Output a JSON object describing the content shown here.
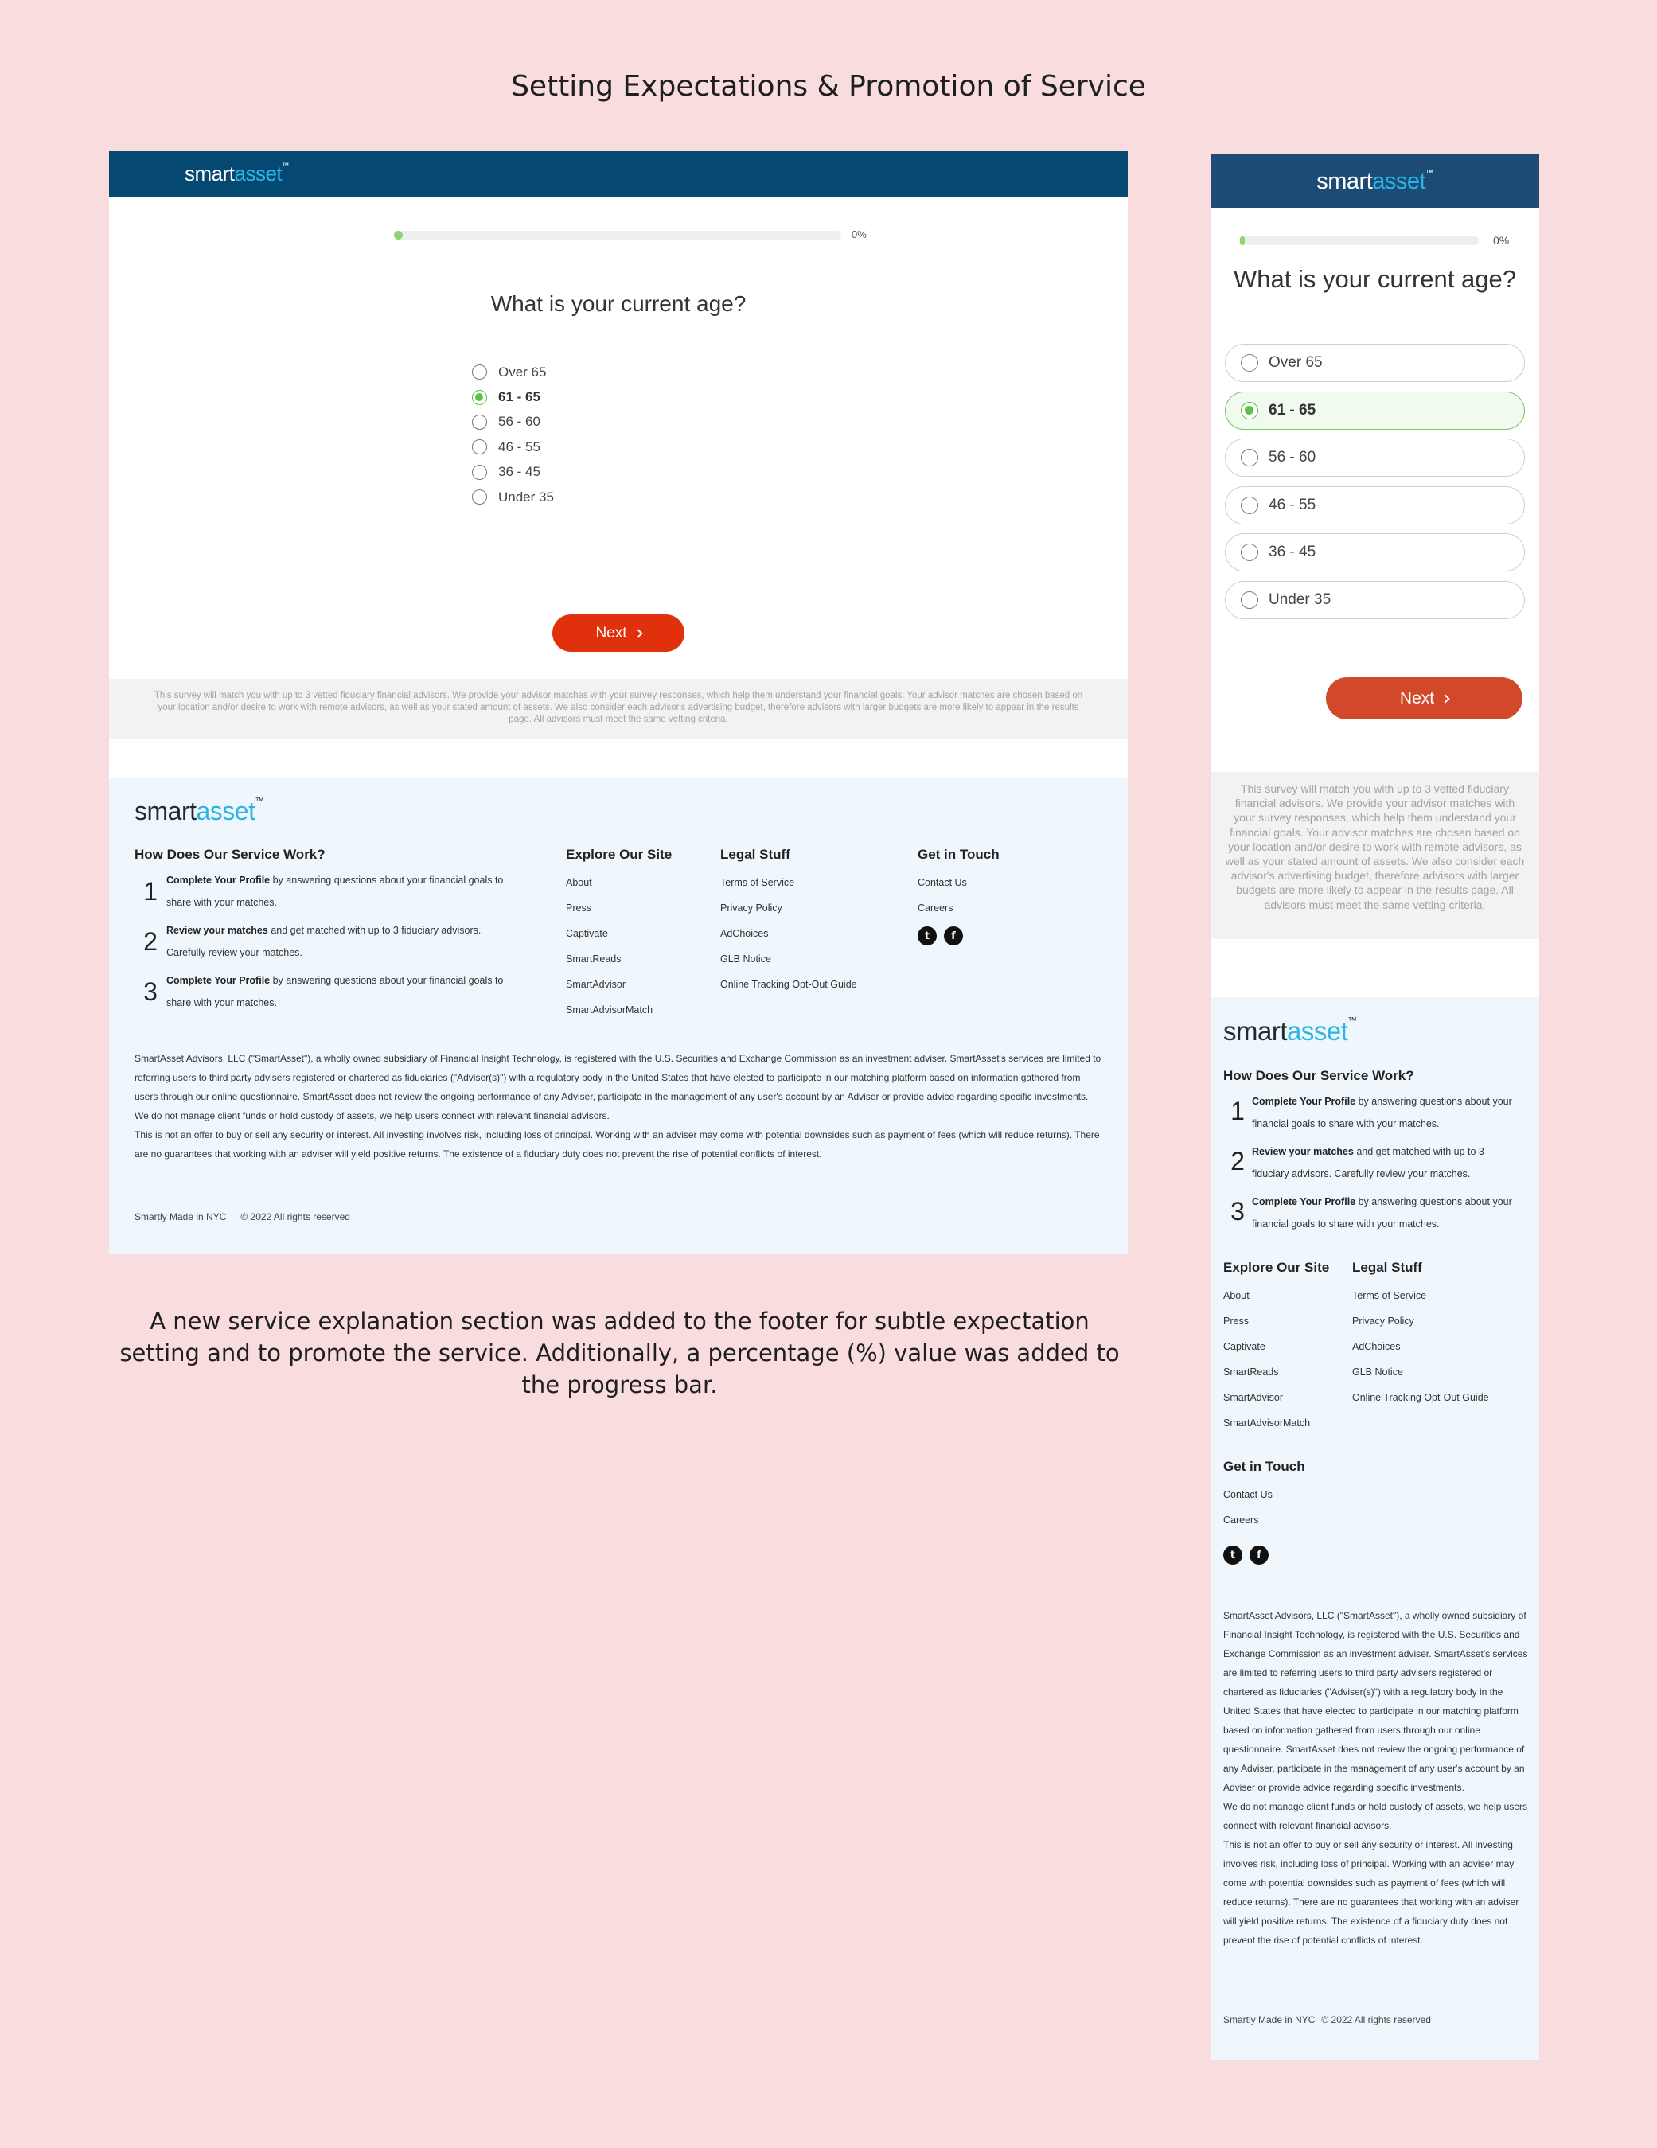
{
  "page_title": "Setting Expectations & Promotion of Service",
  "caption": "A new service explanation section was added to the footer for subtle expectation setting and to promote the service. Additionally, a percentage (%) value was added to the progress bar.",
  "brand": {
    "logo_part1": "smart",
    "logo_part2": "asset",
    "logo_tm": "™"
  },
  "colors": {
    "header": "#054872",
    "accent_green": "#5ec04a",
    "next_button": "#e0310c",
    "footer_bg": "#eff7fc",
    "background": "#f9dcdd"
  },
  "survey": {
    "progress_fraction": 0.02,
    "progress_label": "0%",
    "question": "What is your current age?",
    "options": [
      "Over 65",
      "61 - 65",
      "56 - 60",
      "46 - 55",
      "36 - 45",
      "Under 35"
    ],
    "selected": "61 - 65",
    "next_label": "Next",
    "disclaimer": "This survey will match you with up to 3 vetted fiduciary financial advisors. We provide your advisor matches with your survey responses, which help them understand your financial goals. Your advisor matches are chosen based on your location and/or desire to work with remote advisors, as well as your stated amount of assets. We also consider each advisor's advertising budget, therefore advisors with larger budgets are more likely to appear in the results page. All advisors must meet the same vetting criteria."
  },
  "footer": {
    "how_title": "How Does Our Service Work?",
    "steps": [
      {
        "num": "1",
        "bold": "Complete Your Profile",
        "text": " by answering questions about your financial goals to share with your matches."
      },
      {
        "num": "2",
        "bold": "Review your matches",
        "text": " and get matched with up to 3 fiduciary advisors. Carefully review your matches."
      },
      {
        "num": "3",
        "bold": "Complete Your Profile",
        "text": " by answering questions about your financial goals to share with your matches."
      }
    ],
    "explore_title": "Explore Our Site",
    "explore_links": [
      "About",
      "Press",
      "Captivate",
      "SmartReads",
      "SmartAdvisor",
      "SmartAdvisorMatch"
    ],
    "legal_title": "Legal Stuff",
    "legal_links": [
      "Terms of Service",
      "Privacy Policy",
      "AdChoices",
      "GLB Notice",
      "Online Tracking Opt-Out Guide"
    ],
    "contact_title": "Get in Touch",
    "contact_links": [
      "Contact Us",
      "Careers"
    ],
    "social_icons": [
      "twitter-icon",
      "facebook-icon"
    ],
    "legal_text_1": "SmartAsset Advisors, LLC (\"SmartAsset\"), a wholly owned subsidiary of Financial Insight Technology, is registered with the U.S. Securities and Exchange Commission as an investment adviser. SmartAsset's services are limited to referring users to third party advisers registered or chartered as fiduciaries (\"Adviser(s)\") with a regulatory body in the United States that have elected to participate in our matching platform based on information gathered from users through our online questionnaire. SmartAsset does not review the ongoing performance of any Adviser, participate in the management of any user's account by an Adviser or provide advice regarding specific investments.",
    "legal_text_2": "We do not manage client funds or hold custody of assets, we help users connect with relevant financial advisors.",
    "legal_text_3": "This is not an offer to buy or sell any security or interest. All investing involves risk, including loss of principal. Working with an adviser may come with potential downsides such as payment of fees (which will reduce returns). There are no guarantees that working with an adviser will yield positive returns. The existence of a fiduciary duty does not prevent the rise of potential conflicts of interest.",
    "made_in": "Smartly Made in NYC",
    "copyright": "© 2022 All rights reserved"
  }
}
